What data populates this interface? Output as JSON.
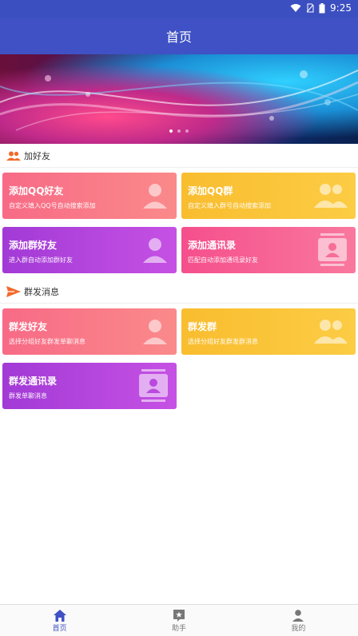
{
  "status": {
    "time": "9:25"
  },
  "appbar": {
    "title": "首页"
  },
  "banner": {
    "dots": 3,
    "active_dot": 0
  },
  "sections": {
    "add": {
      "title": "加好友"
    },
    "mass": {
      "title": "群发消息"
    }
  },
  "cards": {
    "add_qq_friend": {
      "title": "添加QQ好友",
      "desc": "自定义填入QQ号自动搜索添加"
    },
    "add_qq_group": {
      "title": "添加QQ群",
      "desc": "自定义填入群号自动搜索添加"
    },
    "add_group_friend": {
      "title": "添加群好友",
      "desc": "进入群自动添加群好友"
    },
    "add_contacts": {
      "title": "添加通讯录",
      "desc": "匹配自动添加通讯录好友"
    },
    "mass_friend": {
      "title": "群发好友",
      "desc": "选择分组好友群发单聊消息"
    },
    "mass_group": {
      "title": "群发群",
      "desc": "选择分组好友群发群消息"
    },
    "mass_contacts": {
      "title": "群发通讯录",
      "desc": "群发单聊消息"
    }
  },
  "nav": {
    "home": "首页",
    "helper": "助手",
    "mine": "我的"
  },
  "colors": {
    "primary": "#3f51c4",
    "accent_orange": "#f26a2a"
  }
}
